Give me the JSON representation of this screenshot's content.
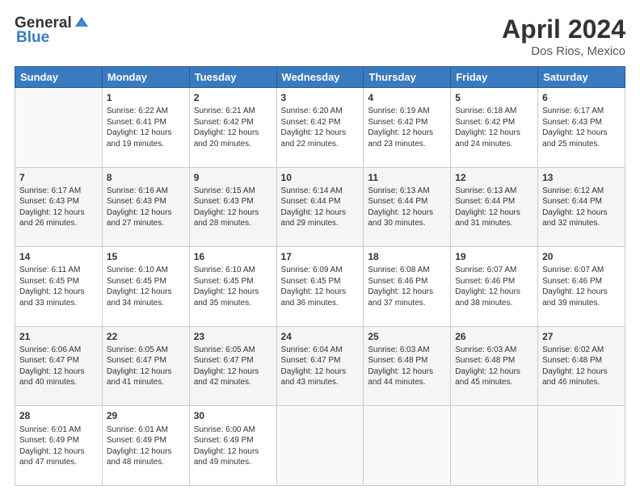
{
  "logo": {
    "general": "General",
    "blue": "Blue"
  },
  "title": "April 2024",
  "subtitle": "Dos Rios, Mexico",
  "days": [
    "Sunday",
    "Monday",
    "Tuesday",
    "Wednesday",
    "Thursday",
    "Friday",
    "Saturday"
  ],
  "weeks": [
    [
      {
        "day": "",
        "content": ""
      },
      {
        "day": "1",
        "content": "Sunrise: 6:22 AM\nSunset: 6:41 PM\nDaylight: 12 hours and 19 minutes."
      },
      {
        "day": "2",
        "content": "Sunrise: 6:21 AM\nSunset: 6:42 PM\nDaylight: 12 hours and 20 minutes."
      },
      {
        "day": "3",
        "content": "Sunrise: 6:20 AM\nSunset: 6:42 PM\nDaylight: 12 hours and 22 minutes."
      },
      {
        "day": "4",
        "content": "Sunrise: 6:19 AM\nSunset: 6:42 PM\nDaylight: 12 hours and 23 minutes."
      },
      {
        "day": "5",
        "content": "Sunrise: 6:18 AM\nSunset: 6:42 PM\nDaylight: 12 hours and 24 minutes."
      },
      {
        "day": "6",
        "content": "Sunrise: 6:17 AM\nSunset: 6:43 PM\nDaylight: 12 hours and 25 minutes."
      }
    ],
    [
      {
        "day": "7",
        "content": "Sunrise: 6:17 AM\nSunset: 6:43 PM\nDaylight: 12 hours and 26 minutes."
      },
      {
        "day": "8",
        "content": "Sunrise: 6:16 AM\nSunset: 6:43 PM\nDaylight: 12 hours and 27 minutes."
      },
      {
        "day": "9",
        "content": "Sunrise: 6:15 AM\nSunset: 6:43 PM\nDaylight: 12 hours and 28 minutes."
      },
      {
        "day": "10",
        "content": "Sunrise: 6:14 AM\nSunset: 6:44 PM\nDaylight: 12 hours and 29 minutes."
      },
      {
        "day": "11",
        "content": "Sunrise: 6:13 AM\nSunset: 6:44 PM\nDaylight: 12 hours and 30 minutes."
      },
      {
        "day": "12",
        "content": "Sunrise: 6:13 AM\nSunset: 6:44 PM\nDaylight: 12 hours and 31 minutes."
      },
      {
        "day": "13",
        "content": "Sunrise: 6:12 AM\nSunset: 6:44 PM\nDaylight: 12 hours and 32 minutes."
      }
    ],
    [
      {
        "day": "14",
        "content": "Sunrise: 6:11 AM\nSunset: 6:45 PM\nDaylight: 12 hours and 33 minutes."
      },
      {
        "day": "15",
        "content": "Sunrise: 6:10 AM\nSunset: 6:45 PM\nDaylight: 12 hours and 34 minutes."
      },
      {
        "day": "16",
        "content": "Sunrise: 6:10 AM\nSunset: 6:45 PM\nDaylight: 12 hours and 35 minutes."
      },
      {
        "day": "17",
        "content": "Sunrise: 6:09 AM\nSunset: 6:45 PM\nDaylight: 12 hours and 36 minutes."
      },
      {
        "day": "18",
        "content": "Sunrise: 6:08 AM\nSunset: 6:46 PM\nDaylight: 12 hours and 37 minutes."
      },
      {
        "day": "19",
        "content": "Sunrise: 6:07 AM\nSunset: 6:46 PM\nDaylight: 12 hours and 38 minutes."
      },
      {
        "day": "20",
        "content": "Sunrise: 6:07 AM\nSunset: 6:46 PM\nDaylight: 12 hours and 39 minutes."
      }
    ],
    [
      {
        "day": "21",
        "content": "Sunrise: 6:06 AM\nSunset: 6:47 PM\nDaylight: 12 hours and 40 minutes."
      },
      {
        "day": "22",
        "content": "Sunrise: 6:05 AM\nSunset: 6:47 PM\nDaylight: 12 hours and 41 minutes."
      },
      {
        "day": "23",
        "content": "Sunrise: 6:05 AM\nSunset: 6:47 PM\nDaylight: 12 hours and 42 minutes."
      },
      {
        "day": "24",
        "content": "Sunrise: 6:04 AM\nSunset: 6:47 PM\nDaylight: 12 hours and 43 minutes."
      },
      {
        "day": "25",
        "content": "Sunrise: 6:03 AM\nSunset: 6:48 PM\nDaylight: 12 hours and 44 minutes."
      },
      {
        "day": "26",
        "content": "Sunrise: 6:03 AM\nSunset: 6:48 PM\nDaylight: 12 hours and 45 minutes."
      },
      {
        "day": "27",
        "content": "Sunrise: 6:02 AM\nSunset: 6:48 PM\nDaylight: 12 hours and 46 minutes."
      }
    ],
    [
      {
        "day": "28",
        "content": "Sunrise: 6:01 AM\nSunset: 6:49 PM\nDaylight: 12 hours and 47 minutes."
      },
      {
        "day": "29",
        "content": "Sunrise: 6:01 AM\nSunset: 6:49 PM\nDaylight: 12 hours and 48 minutes."
      },
      {
        "day": "30",
        "content": "Sunrise: 6:00 AM\nSunset: 6:49 PM\nDaylight: 12 hours and 49 minutes."
      },
      {
        "day": "",
        "content": ""
      },
      {
        "day": "",
        "content": ""
      },
      {
        "day": "",
        "content": ""
      },
      {
        "day": "",
        "content": ""
      }
    ]
  ]
}
